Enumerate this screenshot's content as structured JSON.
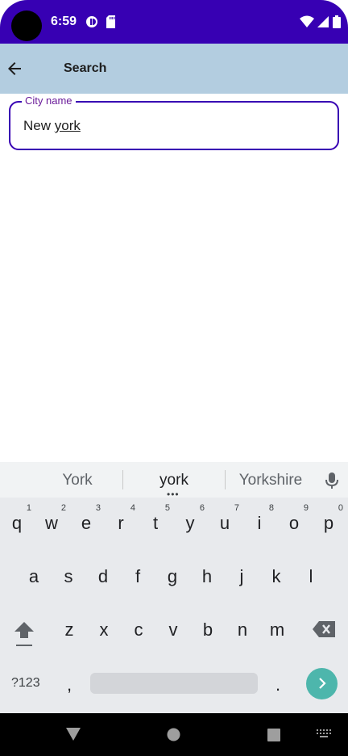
{
  "status_bar": {
    "time": "6:59",
    "icons": [
      "camera-notch",
      "notification-icon",
      "sd-card-icon",
      "wifi-icon",
      "signal-icon",
      "battery-icon"
    ]
  },
  "app_bar": {
    "back_icon": "arrow-back-icon",
    "title": "Search"
  },
  "search_field": {
    "label": "City name",
    "value_plain": "New ",
    "value_composing": "york",
    "accent_color": "#3700b3"
  },
  "keyboard": {
    "suggestions": [
      "York",
      "york",
      "Yorkshire"
    ],
    "row1": [
      {
        "key": "q",
        "hint": "1"
      },
      {
        "key": "w",
        "hint": "2"
      },
      {
        "key": "e",
        "hint": "3"
      },
      {
        "key": "r",
        "hint": "4"
      },
      {
        "key": "t",
        "hint": "5"
      },
      {
        "key": "y",
        "hint": "6"
      },
      {
        "key": "u",
        "hint": "7"
      },
      {
        "key": "i",
        "hint": "8"
      },
      {
        "key": "o",
        "hint": "9"
      },
      {
        "key": "p",
        "hint": "0"
      }
    ],
    "row2": [
      "a",
      "s",
      "d",
      "f",
      "g",
      "h",
      "j",
      "k",
      "l"
    ],
    "row3": [
      "z",
      "x",
      "c",
      "v",
      "b",
      "n",
      "m"
    ],
    "symbols_label": "?123",
    "comma": ",",
    "period": ".",
    "accent_color": "#4db6ac"
  },
  "nav_bar": {
    "icons": [
      "back-triangle-icon",
      "home-circle-icon",
      "recents-square-icon",
      "keyboard-switch-icon"
    ]
  }
}
